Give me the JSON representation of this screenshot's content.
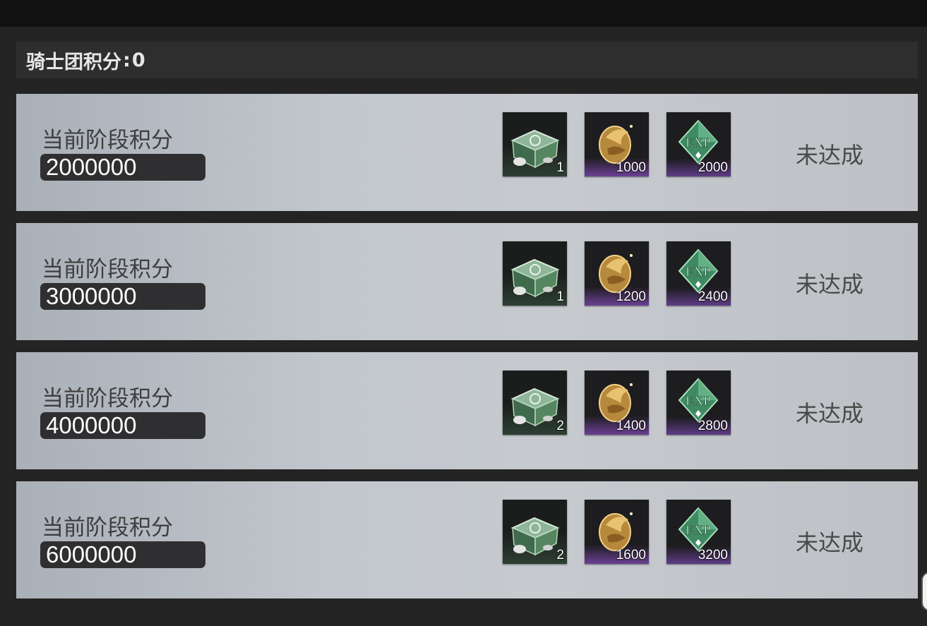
{
  "header": {
    "label": "骑士团积分",
    "separator": ":",
    "value": "0"
  },
  "stages": [
    {
      "label": "当前阶段积分",
      "score": "2000000",
      "rewards": {
        "box": "1",
        "coin": "1000",
        "exp": "2000"
      },
      "status": "未达成"
    },
    {
      "label": "当前阶段积分",
      "score": "3000000",
      "rewards": {
        "box": "1",
        "coin": "1200",
        "exp": "2400"
      },
      "status": "未达成"
    },
    {
      "label": "当前阶段积分",
      "score": "4000000",
      "rewards": {
        "box": "2",
        "coin": "1400",
        "exp": "2800"
      },
      "status": "未达成"
    },
    {
      "label": "当前阶段积分",
      "score": "6000000",
      "rewards": {
        "box": "2",
        "coin": "1600",
        "exp": "3200"
      },
      "status": "未达成"
    }
  ],
  "icons": {
    "box": "green-chest-icon",
    "coin": "gold-coin-icon",
    "exp": "exp-crystal-icon"
  },
  "colors": {
    "rarity_purple": "#6b3f93",
    "rarity_green": "#2d3f33",
    "row_bg": "#c2c7cd"
  }
}
